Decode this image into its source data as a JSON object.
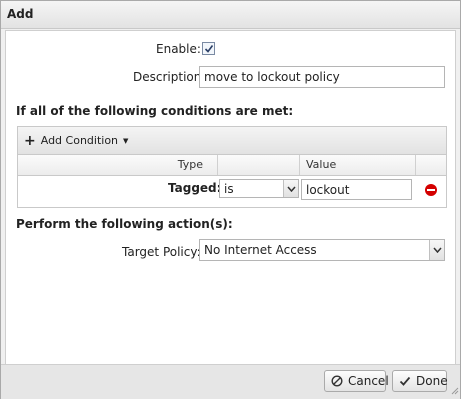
{
  "dialog": {
    "title": "Add"
  },
  "form": {
    "enable_label": "Enable:",
    "enable_checked": true,
    "description_label": "Description:",
    "description_value": "move to lockout policy"
  },
  "conditions": {
    "heading": "If all of the following conditions are met:",
    "add_condition_label": "Add Condition",
    "columns": {
      "type": "Type",
      "operator": "",
      "value": "Value"
    },
    "rows": [
      {
        "type": "Tagged:",
        "operator": "is",
        "value": "lockout"
      }
    ]
  },
  "actions": {
    "heading": "Perform the following action(s):",
    "target_policy_label": "Target Policy:",
    "target_policy_value": "No Internet Access"
  },
  "footer": {
    "cancel_label": "Cancel",
    "done_label": "Done"
  }
}
